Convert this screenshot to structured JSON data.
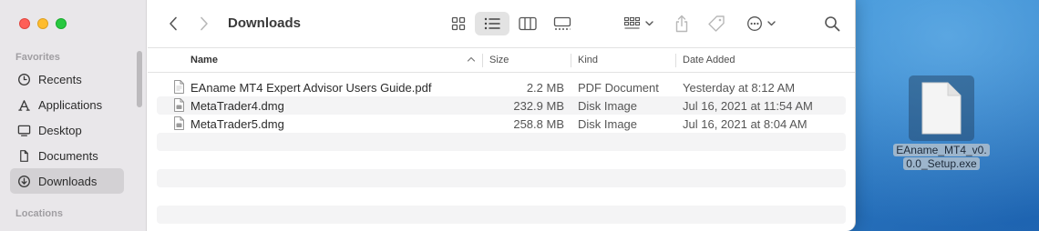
{
  "window": {
    "title": "Downloads"
  },
  "sidebar": {
    "sections": [
      {
        "label": "Favorites"
      },
      {
        "label": "Locations"
      }
    ],
    "items": [
      {
        "label": "Recents",
        "icon": "clock-icon"
      },
      {
        "label": "Applications",
        "icon": "applications-icon"
      },
      {
        "label": "Desktop",
        "icon": "desktop-icon"
      },
      {
        "label": "Documents",
        "icon": "document-icon"
      },
      {
        "label": "Downloads",
        "icon": "download-icon",
        "active": true
      }
    ]
  },
  "toolbar": {
    "back_icon": "chevron-left-icon",
    "forward_icon": "chevron-right-icon",
    "views": [
      "icon-view",
      "list-view",
      "column-view",
      "gallery-view"
    ],
    "active_view": "list-view",
    "group_icon": "group-by-icon",
    "share_icon": "share-icon",
    "tag_icon": "tag-icon",
    "more_icon": "more-actions-icon",
    "search_icon": "search-icon"
  },
  "columns": {
    "name": "Name",
    "size": "Size",
    "kind": "Kind",
    "date": "Date Added"
  },
  "files": [
    {
      "name": "EAname MT4 Expert Advisor Users Guide.pdf",
      "size": "2.2 MB",
      "kind": "PDF Document",
      "date": "Yesterday at 8:12 AM"
    },
    {
      "name": "MetaTrader4.dmg",
      "size": "232.9 MB",
      "kind": "Disk Image",
      "date": "Jul 16, 2021 at 11:54 AM"
    },
    {
      "name": "MetaTrader5.dmg",
      "size": "258.8 MB",
      "kind": "Disk Image",
      "date": "Jul 16, 2021 at 8:04 AM"
    }
  ],
  "desktop": {
    "file_label": "EAname_MT4_v0.0.0_Setup.exe",
    "file_label_line1": "EAname_MT4_v0.",
    "file_label_line2": "0.0_Setup.exe"
  },
  "colors": {
    "accent_close": "#fe5f57",
    "accent_min": "#febc2e",
    "accent_max": "#28c840",
    "sidebar_bg": "#e9e7ea",
    "desktop_bg": "#2f86cf"
  }
}
